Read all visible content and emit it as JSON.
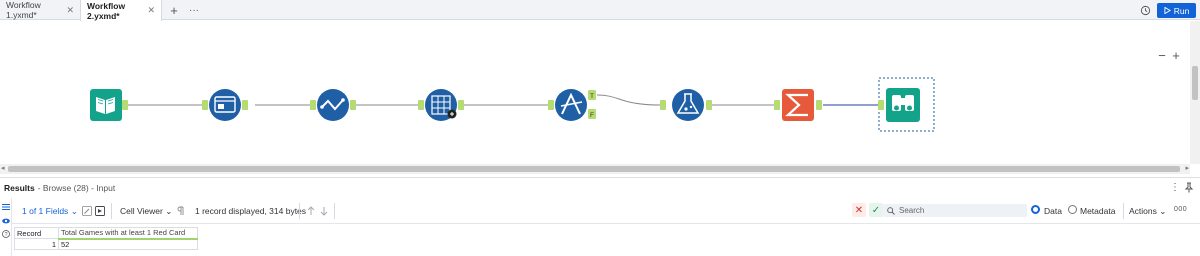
{
  "tabs": [
    {
      "label": "Workflow 1.yxmd*"
    },
    {
      "label": "Workflow 2.yxmd*"
    }
  ],
  "run_label": "Run",
  "colors": {
    "accent": "#1363d8",
    "tool_teal": "#13a38b",
    "tool_blue": "#1f5fa6",
    "tool_orange": "#e6593b",
    "anchor_green": "#b5dc72"
  },
  "canvas": {
    "tools": [
      {
        "icon": "input-data-book-icon"
      },
      {
        "icon": "select-tool-icon"
      },
      {
        "icon": "formula-tool-icon"
      },
      {
        "icon": "multi-row-formula-icon"
      },
      {
        "icon": "filter-tool-icon",
        "anchors": [
          "T",
          "F"
        ]
      },
      {
        "icon": "formula-flask-icon"
      },
      {
        "icon": "summarize-sigma-icon"
      },
      {
        "icon": "browse-binoculars-icon"
      }
    ]
  },
  "results": {
    "title": "Results",
    "subtitle": "- Browse (28) - Input"
  },
  "toolbar": {
    "fields_label": "1 of 1 Fields",
    "cell_viewer_label": "Cell Viewer",
    "records_info": "1 record displayed, 314 bytes",
    "search_placeholder": "Search",
    "data_label": "Data",
    "metadata_label": "Metadata",
    "actions_label": "Actions"
  },
  "table": {
    "headers": [
      "Record",
      "Total Games with at least 1 Red Card"
    ],
    "rows": [
      [
        "1",
        "52"
      ]
    ]
  }
}
